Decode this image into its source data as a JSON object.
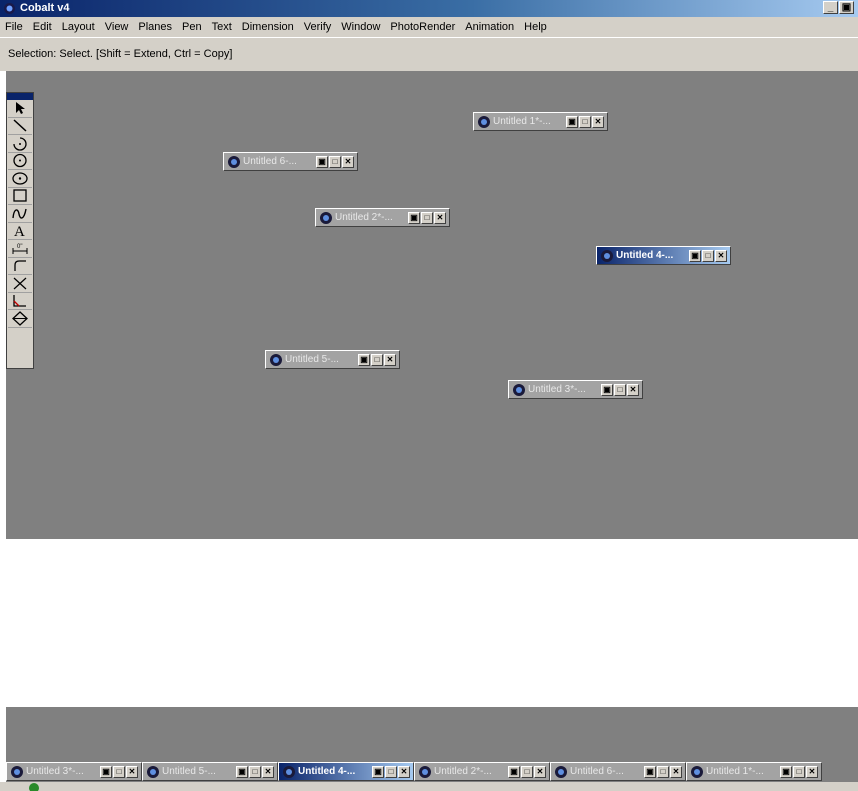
{
  "app": {
    "title": "Cobalt v4"
  },
  "window_buttons": {
    "minimize": "_",
    "restore": "B"
  },
  "menu": [
    "File",
    "Edit",
    "Layout",
    "View",
    "Planes",
    "Pen",
    "Text",
    "Dimension",
    "Verify",
    "Window",
    "PhotoRender",
    "Animation",
    "Help"
  ],
  "status": {
    "prompt": "Selection: Select. [Shift = Extend, Ctrl = Copy]"
  },
  "minimized_windows": [
    {
      "title": "Untitled 1*-...",
      "active": false
    },
    {
      "title": "Untitled 6-...",
      "active": false
    },
    {
      "title": "Untitled 2*-...",
      "active": false
    },
    {
      "title": "Untitled 4-...",
      "active": true
    },
    {
      "title": "Untitled 5-...",
      "active": false
    },
    {
      "title": "Untitled 3*-...",
      "active": false
    }
  ],
  "taskstrip": [
    {
      "title": "Untitled 3*-...",
      "active": false
    },
    {
      "title": "Untitled 5-...",
      "active": false
    },
    {
      "title": "Untitled 4-...",
      "active": true
    },
    {
      "title": "Untitled 2*-...",
      "active": false
    },
    {
      "title": "Untitled 6-...",
      "active": false
    },
    {
      "title": "Untitled 1*-...",
      "active": false
    }
  ],
  "tools": [
    "select-arrow-icon",
    "line-icon",
    "arc-icon",
    "circle-icon",
    "ellipse-icon",
    "rectangle-icon",
    "spline-icon",
    "text-tool-icon",
    "dimension-icon",
    "fillet-icon",
    "trim-icon",
    "chamfer-icon",
    "plane-icon"
  ],
  "colors": {
    "workspace": "#808080",
    "chrome": "#d4d0c8",
    "active_title": "#0a246a"
  }
}
